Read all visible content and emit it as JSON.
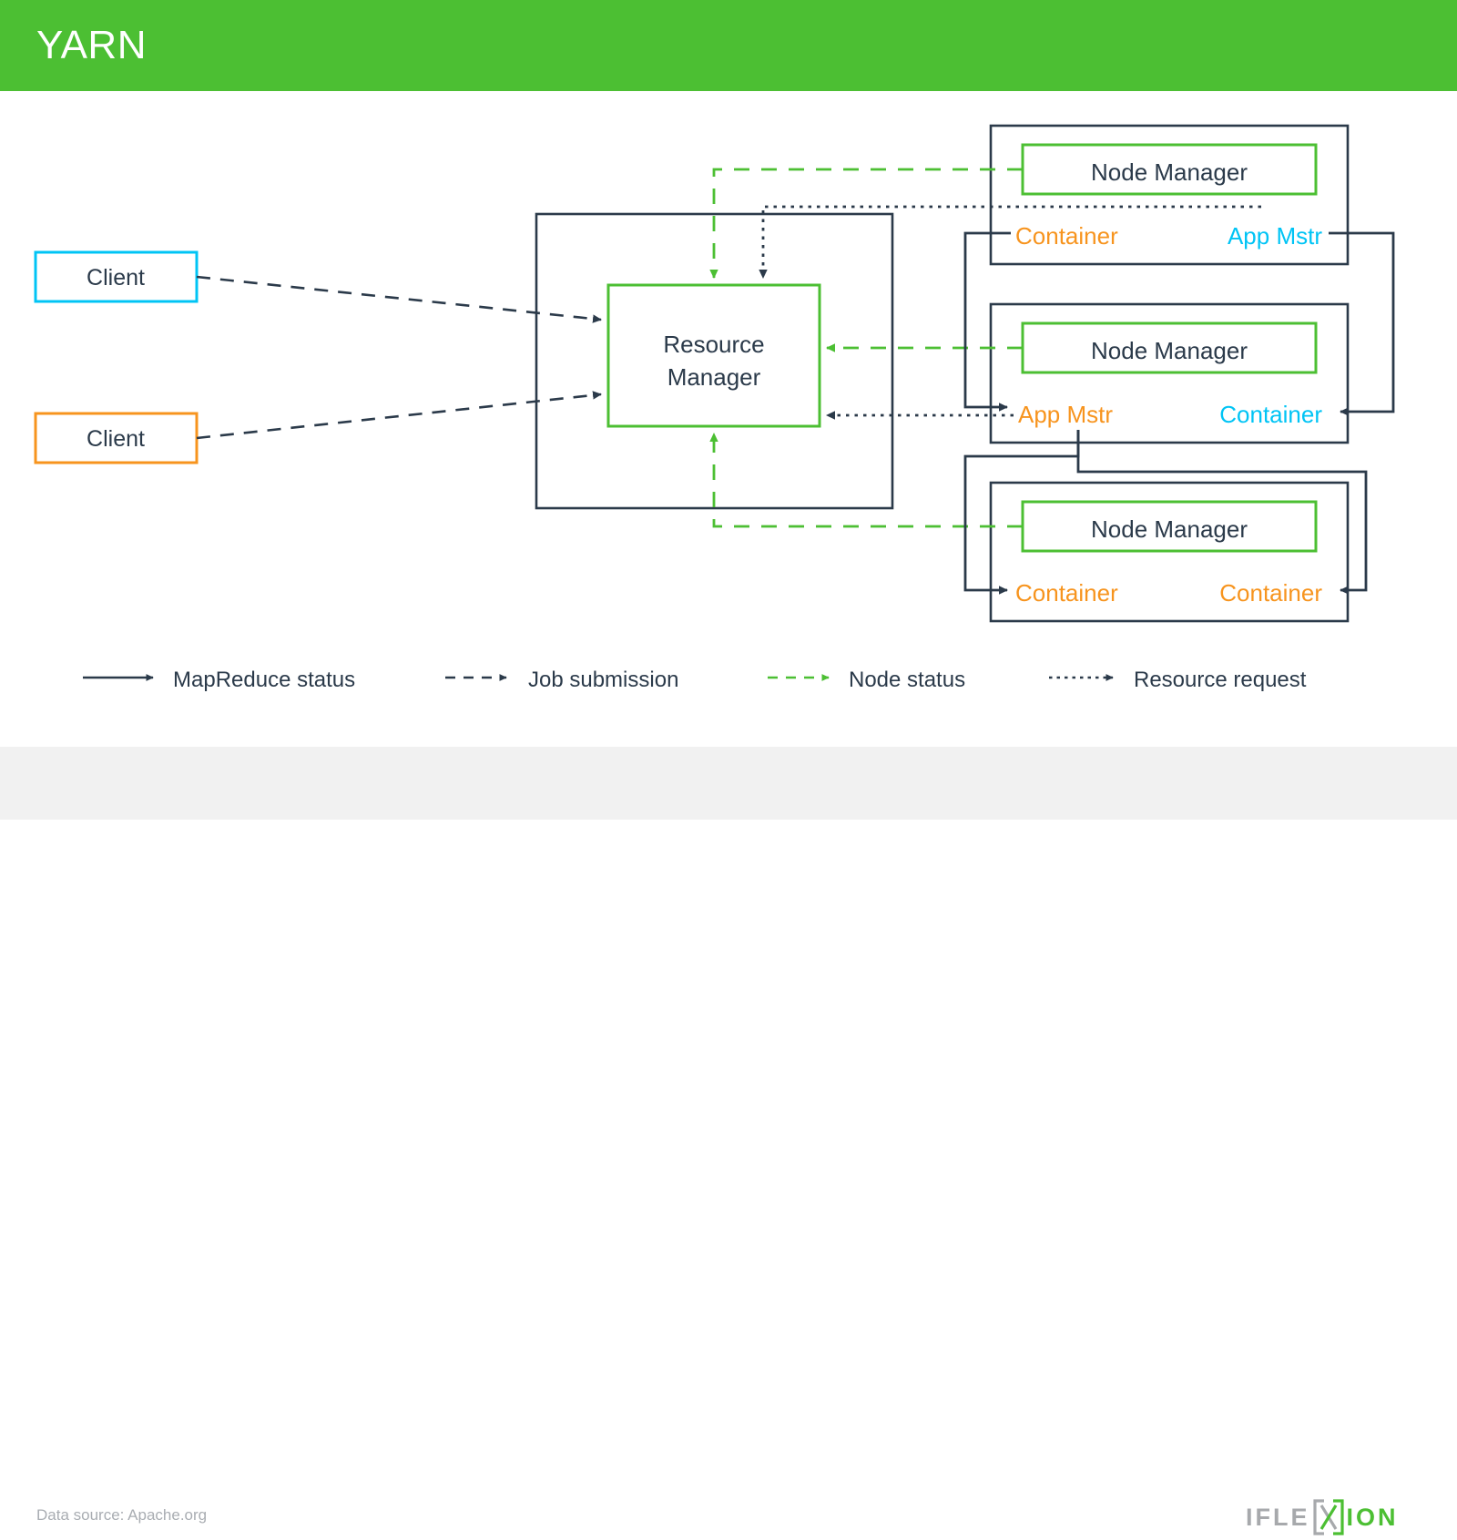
{
  "header": {
    "title": "YARN",
    "bg_color": "#4cbf33",
    "text_color": "#ffffff"
  },
  "footer": {
    "data_source": "Data source: Apache.org",
    "bg_color": "#f1f1f1",
    "text_color": "#a9adb2",
    "logo": {
      "prefix": "IFLE",
      "mark": "X",
      "suffix": "ION",
      "prefix_color": "#a7a9ac",
      "suffix_color": "#4cbf33"
    }
  },
  "palette": {
    "green": "#4cbf33",
    "orange": "#f7941e",
    "cyan": "#00c4f5",
    "navy": "#2b3a4a",
    "white": "#ffffff"
  },
  "diagram": {
    "clients": [
      {
        "label": "Client",
        "border_color": "#00c4f5"
      },
      {
        "label": "Client",
        "border_color": "#f7941e"
      }
    ],
    "resource_manager": {
      "line1": "Resource",
      "line2": "Manager",
      "border_color": "#4cbf33"
    },
    "nodes": [
      {
        "title": "Node Manager",
        "title_border_color": "#4cbf33",
        "left_label": "Container",
        "left_color": "#f7941e",
        "right_label": "App Mstr",
        "right_color": "#00c4f5"
      },
      {
        "title": "Node Manager",
        "title_border_color": "#4cbf33",
        "left_label": "App Mstr",
        "left_color": "#f7941e",
        "right_label": "Container",
        "right_color": "#00c4f5"
      },
      {
        "title": "Node Manager",
        "title_border_color": "#4cbf33",
        "left_label": "Container",
        "left_color": "#f7941e",
        "right_label": "Container",
        "right_color": "#f7941e"
      }
    ]
  },
  "legend": [
    {
      "label": "MapReduce status",
      "style": "solid",
      "color": "#2b3a4a"
    },
    {
      "label": "Job submission",
      "style": "dashed",
      "color": "#2b3a4a"
    },
    {
      "label": "Node status",
      "style": "dashed",
      "color": "#4cbf33"
    },
    {
      "label": "Resource request",
      "style": "dotted",
      "color": "#2b3a4a"
    }
  ]
}
